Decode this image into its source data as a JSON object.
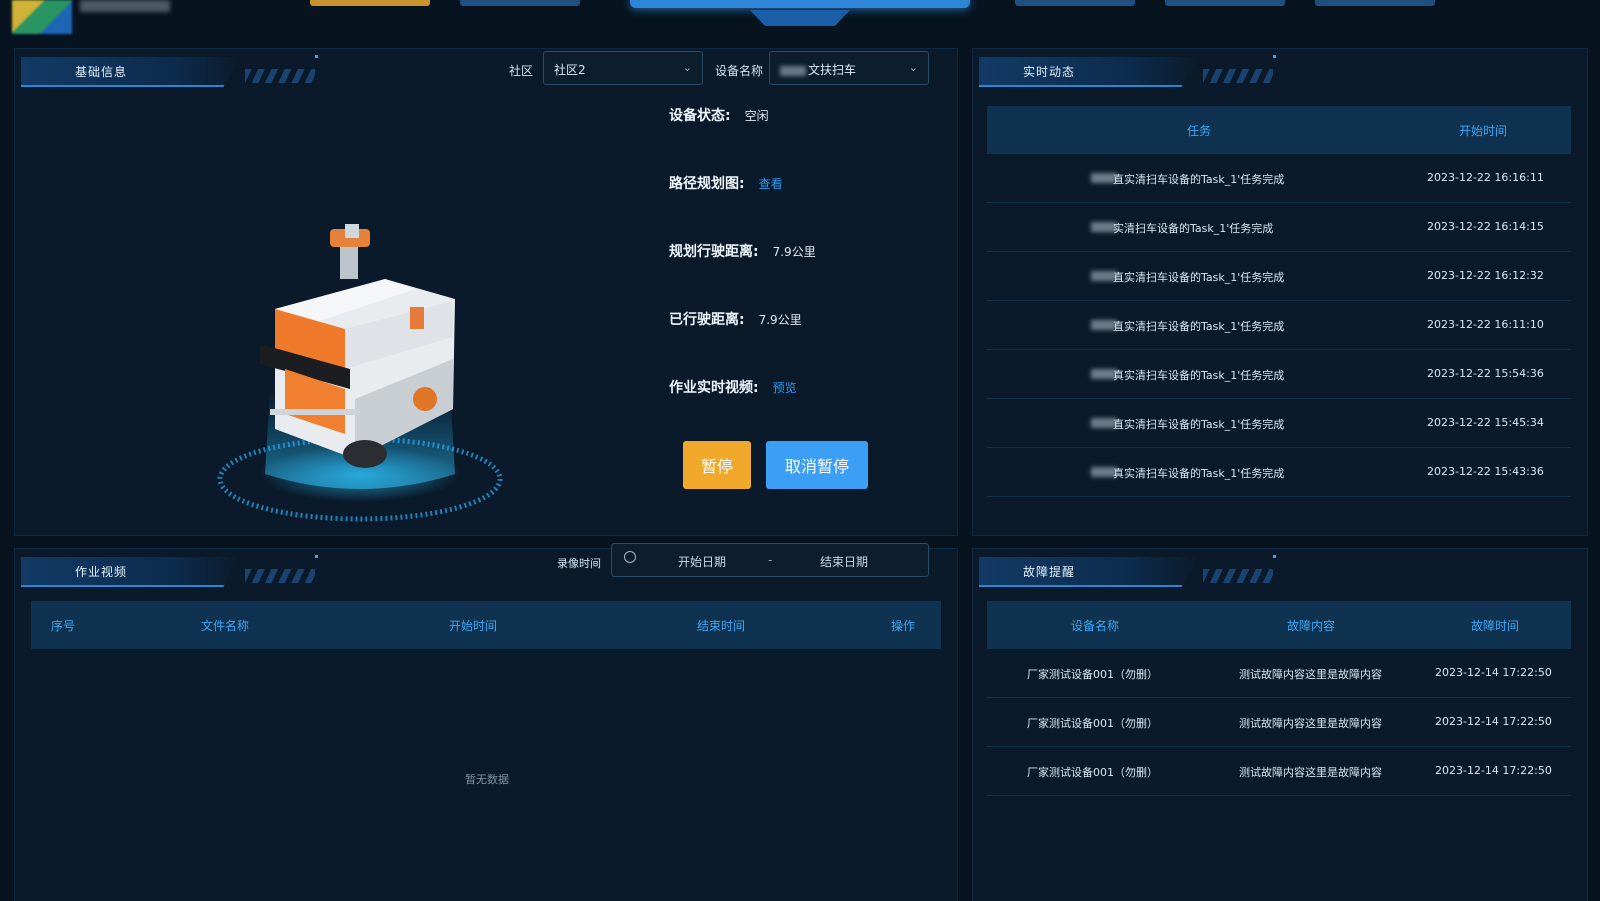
{
  "basic": {
    "title": "基础信息",
    "community_label": "社区",
    "community_value": "社区2",
    "device_label": "设备名称",
    "device_value": "文扶扫车",
    "status_key": "设备状态:",
    "status_val": "空闲",
    "route_key": "路径规划图:",
    "route_link": "查看",
    "plan_key": "规划行驶距离:",
    "plan_val": "7.9公里",
    "done_key": "已行驶距离:",
    "done_val": "7.9公里",
    "video_key": "作业实时视频:",
    "video_link": "预览",
    "pause_btn": "暂停",
    "cancel_btn": "取消暂停"
  },
  "realtime": {
    "title": "实时动态",
    "col_task": "任务",
    "col_time": "开始时间",
    "rows": [
      {
        "task": "直实清扫车设备的Task_1'任务完成",
        "time": "2023-12-22 16:16:11"
      },
      {
        "task": "实清扫车设备的Task_1'任务完成",
        "time": "2023-12-22 16:14:15"
      },
      {
        "task": "直实清扫车设备的Task_1'任务完成",
        "time": "2023-12-22 16:12:32"
      },
      {
        "task": "直实清扫车设备的Task_1'任务完成",
        "time": "2023-12-22 16:11:10"
      },
      {
        "task": "真实清扫车设备的Task_1'任务完成",
        "time": "2023-12-22 15:54:36"
      },
      {
        "task": "直实清扫车设备的Task_1'任务完成",
        "time": "2023-12-22 15:45:34"
      },
      {
        "task": "真实清扫车设备的Task_1'任务完成",
        "time": "2023-12-22 15:43:36"
      }
    ]
  },
  "video": {
    "title": "作业视频",
    "time_label": "录像时间",
    "start_placeholder": "开始日期",
    "dash": "-",
    "end_placeholder": "结束日期",
    "cols": [
      "序号",
      "文件名称",
      "开始时间",
      "结束时间",
      "操作"
    ],
    "empty": "暂无数据"
  },
  "fault": {
    "title": "故障提醒",
    "cols": [
      "设备名称",
      "故障内容",
      "故障时间"
    ],
    "rows": [
      {
        "name": "厂家测试设备001（勿删）",
        "content": "测试故障内容这里是故障内容",
        "time": "2023-12-14 17:22:50"
      },
      {
        "name": "厂家测试设备001（勿删）",
        "content": "测试故障内容这里是故障内容",
        "time": "2023-12-14 17:22:50"
      },
      {
        "name": "厂家测试设备001（勿删）",
        "content": "测试故障内容这里是故障内容",
        "time": "2023-12-14 17:22:50"
      }
    ]
  },
  "colors": {
    "accent": "#3fa6f5",
    "pause": "#f0a92a",
    "cancel": "#3b9ff5"
  }
}
